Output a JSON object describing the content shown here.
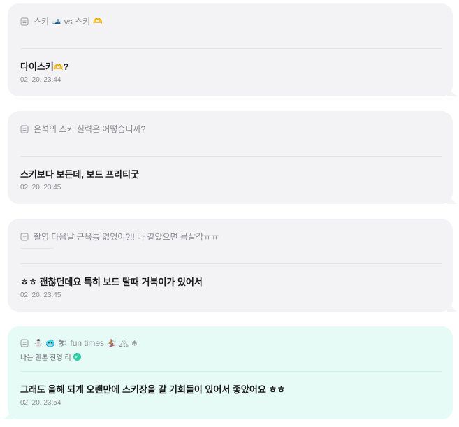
{
  "cards": [
    {
      "question": "스키",
      "question_emoji1": "🎿",
      "question_mid": " vs 스키",
      "question_emoji2": "🫶",
      "answer_text": "다이스키",
      "answer_emoji": "🫶",
      "answer_tail": "?",
      "time": "02. 20. 23:44"
    },
    {
      "question": "은석의 스키 실력은 어떻습니까?",
      "answer": "스키보다 보든데, 보드 프리티굿",
      "time": "02. 20. 23:45"
    },
    {
      "question": "촬영 다음날 근육통 없었어?!! 나 같았으면 몸살각ㅠㅠ",
      "answer": "ㅎㅎ 괜찮던데요 특히 보드 탈때 거북이가 있어서",
      "time": "02. 20. 23:45"
    },
    {
      "question_emojis_left": "⛄ 🥶 ⛷",
      "question": " fun times ",
      "question_emojis_right": "🏂 🏔 ❄",
      "artist": "나는 앤톤 찬영 리",
      "answer": "그래도 올해 되게 오랜만에 스키장을 갈 기회들이 있어서 좋았어요 ㅎㅎ",
      "time": "02. 20. 23:54"
    }
  ],
  "colors": {
    "card_grey": "#f3f3f5",
    "card_teal": "#e6fbf6",
    "verified": "#2ecda6"
  }
}
